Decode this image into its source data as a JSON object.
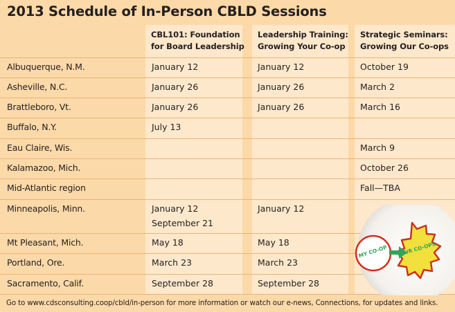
{
  "title": "2013 Schedule of In-Person CBLD Sessions",
  "columns": [
    {
      "line1": "CBL101: Foundation",
      "line2": "for Board Leadership"
    },
    {
      "line1": "Leadership Training:",
      "line2": "Growing Your Co-op"
    },
    {
      "line1": "Strategic Seminars:",
      "line2": "Growing Our Co-ops"
    }
  ],
  "rows": [
    {
      "city": "Albuquerque, N.M.",
      "cbl101": "January 12",
      "leadership": "January 12",
      "strategic": "October 19"
    },
    {
      "city": "Asheville, N.C.",
      "cbl101": "January 26",
      "leadership": "January 26",
      "strategic": "March 2"
    },
    {
      "city": "Brattleboro, Vt.",
      "cbl101": "January 26",
      "leadership": "January 26",
      "strategic": "March 16"
    },
    {
      "city": "Buffalo, N.Y.",
      "cbl101": "July 13",
      "leadership": "",
      "strategic": ""
    },
    {
      "city": "Eau Claire, Wis.",
      "cbl101": "",
      "leadership": "",
      "strategic": "March 9"
    },
    {
      "city": "Kalamazoo, Mich.",
      "cbl101": "",
      "leadership": "",
      "strategic": "October 26"
    },
    {
      "city": "Mid-Atlantic region",
      "cbl101": "",
      "leadership": "",
      "strategic": "Fall—TBA"
    },
    {
      "city": "Minneapolis, Minn.",
      "cbl101": "January 12",
      "cbl101_extra": "September 21",
      "leadership": "January 12",
      "strategic": ""
    },
    {
      "city": "Mt Pleasant, Mich.",
      "cbl101": "May 18",
      "leadership": "May 18",
      "strategic": ""
    },
    {
      "city": "Portland, Ore.",
      "cbl101": "March 23",
      "leadership": "March 23",
      "strategic": ""
    },
    {
      "city": "Sacramento, Calif.",
      "cbl101": "September 28",
      "leadership": "September 28",
      "strategic": ""
    }
  ],
  "badge": {
    "left_text": "MY CO-OP",
    "right_text": "OUR CO-OPS"
  },
  "footer": "Go to www.cdsconsulting.coop/cbld/in-person for more information or watch our e-news, Connections, for updates and links.",
  "colors": {
    "background": "#fcd9a8",
    "column_fill": "#fee8cb",
    "rule": "#e8b479",
    "text": "#231f20"
  }
}
